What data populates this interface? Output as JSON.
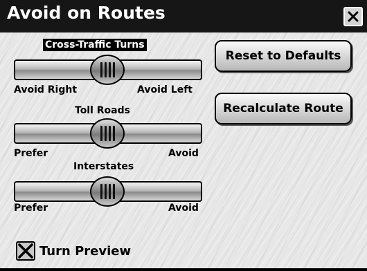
{
  "window": {
    "title": "Avoid on Routes"
  },
  "sliders": [
    {
      "title": "Cross-Traffic Turns",
      "left_label": "Avoid Right",
      "right_label": "Avoid Left",
      "value": 0.5
    },
    {
      "title": "Toll Roads",
      "left_label": "Prefer",
      "right_label": "Avoid",
      "value": 0.5
    },
    {
      "title": "Interstates",
      "left_label": "Prefer",
      "right_label": "Avoid",
      "value": 0.5
    }
  ],
  "buttons": {
    "reset": "Reset to Defaults",
    "recalculate": "Recalculate Route"
  },
  "turn_preview": {
    "label": "Turn Preview",
    "checked": true
  },
  "icons": {
    "close": "close-icon",
    "check": "x-check-icon",
    "grip": "slider-grip-icon"
  }
}
